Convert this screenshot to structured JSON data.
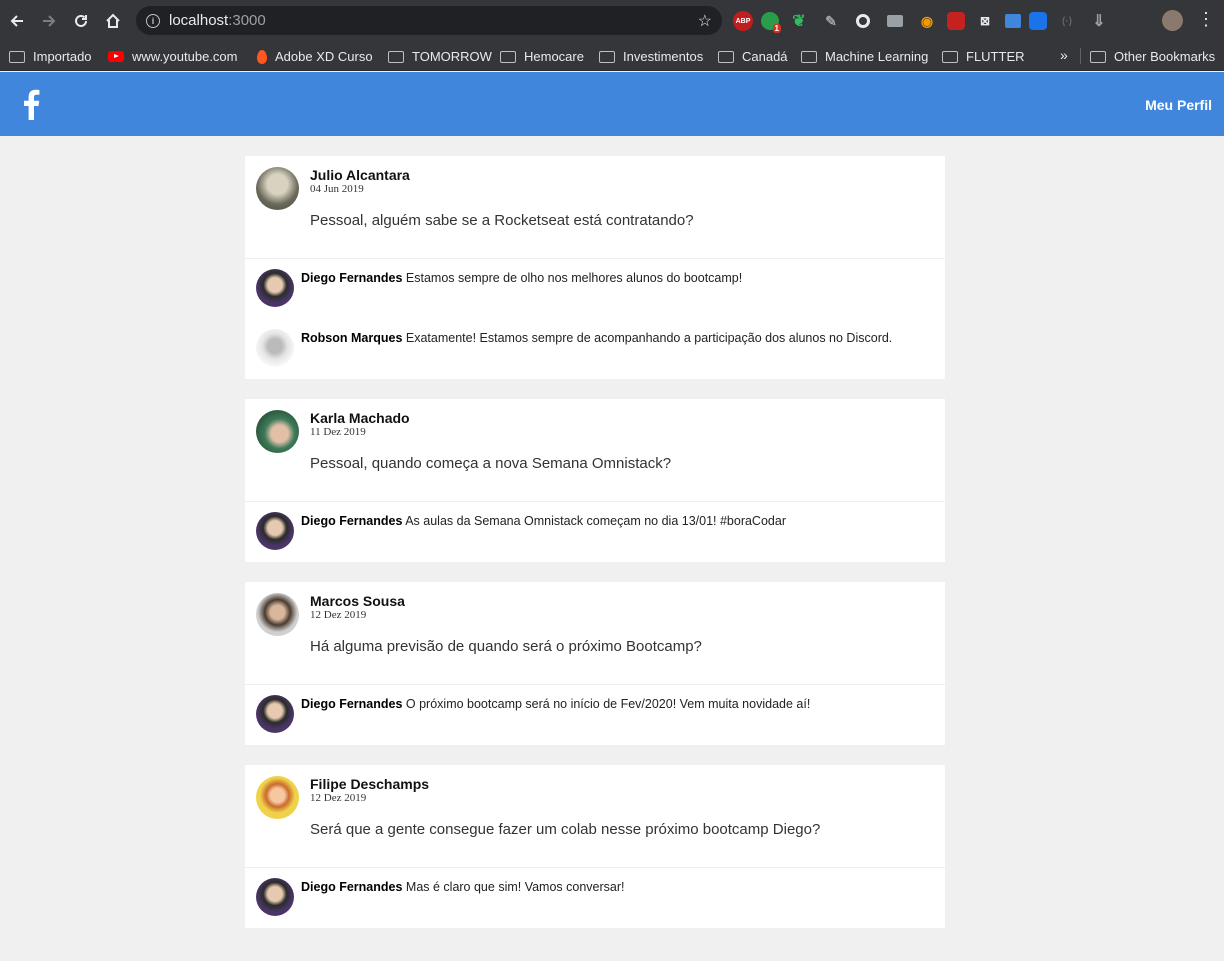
{
  "browser": {
    "url_host": "localhost",
    "url_port": ":3000",
    "extensions": [
      "ABP",
      "1"
    ],
    "bookmarks": [
      {
        "label": "Importado",
        "icon": "folder-icon"
      },
      {
        "label": "www.youtube.com",
        "icon": "youtube-icon"
      },
      {
        "label": "Adobe XD Curso",
        "icon": "flame-icon"
      },
      {
        "label": "TOMORROW",
        "icon": "folder-icon"
      },
      {
        "label": "Hemocare",
        "icon": "folder-icon"
      },
      {
        "label": "Investimentos",
        "icon": "folder-icon"
      },
      {
        "label": "Canadá",
        "icon": "folder-icon"
      },
      {
        "label": "Machine Learning",
        "icon": "folder-icon"
      },
      {
        "label": "FLUTTER",
        "icon": "folder-icon"
      }
    ],
    "more_bookmarks": "»",
    "other_bookmarks": "Other Bookmarks"
  },
  "header": {
    "profile_link": "Meu Perfil",
    "brand_color": "#4186dd"
  },
  "posts": [
    {
      "author": "Julio Alcantara",
      "date": "04 Jun 2019",
      "content": "Pessoal, alguém sabe se a Rocketseat está contratando?",
      "avatar_color": "#6b6a5a",
      "comments": [
        {
          "author": "Diego Fernandes",
          "text": "Estamos sempre de olho nos melhores alunos do bootcamp!",
          "avatar_color": "#4a3566"
        },
        {
          "author": "Robson Marques",
          "text": "Exatamente! Estamos sempre de acompanhando a participação dos alunos no Discord.",
          "avatar_color": "#dcdcdc"
        }
      ]
    },
    {
      "author": "Karla Machado",
      "date": "11 Dez 2019",
      "content": "Pessoal, quando começa a nova Semana Omnistack?",
      "avatar_color": "#3d7a5a",
      "comments": [
        {
          "author": "Diego Fernandes",
          "text": "As aulas da Semana Omnistack começam no dia 13/01! #boraCodar",
          "avatar_color": "#4a3566"
        }
      ]
    },
    {
      "author": "Marcos Sousa",
      "date": "12 Dez 2019",
      "content": "Há alguma previsão de quando será o próximo Bootcamp?",
      "avatar_color": "#c9c9c9",
      "comments": [
        {
          "author": "Diego Fernandes",
          "text": "O próximo bootcamp será no início de Fev/2020! Vem muita novidade aí!",
          "avatar_color": "#4a3566"
        }
      ]
    },
    {
      "author": "Filipe Deschamps",
      "date": "12 Dez 2019",
      "content": "Será que a gente consegue fazer um colab nesse próximo bootcamp Diego?",
      "avatar_color": "#f0d24a",
      "comments": [
        {
          "author": "Diego Fernandes",
          "text": "Mas é claro que sim! Vamos conversar!",
          "avatar_color": "#4a3566"
        }
      ]
    }
  ]
}
